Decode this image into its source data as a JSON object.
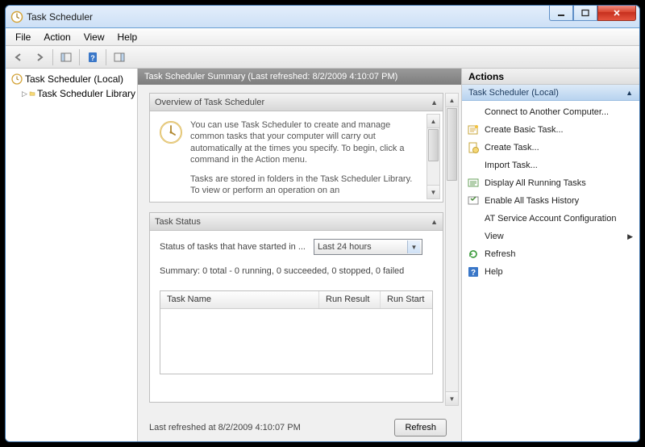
{
  "window": {
    "title": "Task Scheduler"
  },
  "menu": {
    "file": "File",
    "action": "Action",
    "view": "View",
    "help": "Help"
  },
  "tree": {
    "root": "Task Scheduler (Local)",
    "library": "Task Scheduler Library"
  },
  "summary": {
    "header": "Task Scheduler Summary (Last refreshed: 8/2/2009 4:10:07 PM)",
    "overview_title": "Overview of Task Scheduler",
    "overview_p1": "You can use Task Scheduler to create and manage common tasks that your computer will carry out automatically at the times you specify. To begin, click a command in the Action menu.",
    "overview_p2": "Tasks are stored in folders in the Task Scheduler Library. To view or perform an operation on an",
    "status_title": "Task Status",
    "status_label": "Status of tasks that have started in ...",
    "status_combo": "Last 24 hours",
    "status_summary": "Summary: 0 total - 0 running, 0 succeeded, 0 stopped, 0 failed",
    "table_cols": {
      "c1": "Task Name",
      "c2": "Run Result",
      "c3": "Run Start"
    },
    "footer": "Last refreshed at 8/2/2009 4:10:07 PM",
    "refresh_btn": "Refresh"
  },
  "actions": {
    "title": "Actions",
    "group_title": "Task Scheduler (Local)",
    "items": {
      "connect": "Connect to Another Computer...",
      "basic": "Create Basic Task...",
      "create": "Create Task...",
      "import": "Import Task...",
      "display": "Display All Running Tasks",
      "enable": "Enable All Tasks History",
      "at": "AT Service Account Configuration",
      "view": "View",
      "refresh": "Refresh",
      "help": "Help"
    }
  }
}
